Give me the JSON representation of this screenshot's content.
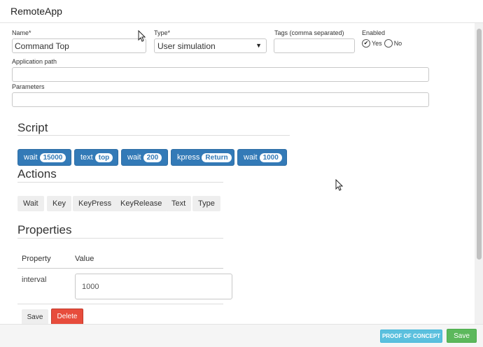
{
  "header": {
    "title": "RemoteApp"
  },
  "form": {
    "name": {
      "label": "Name*",
      "value": "Command Top"
    },
    "type": {
      "label": "Type*",
      "value": "User simulation"
    },
    "tags": {
      "label": "Tags (comma separated)",
      "value": ""
    },
    "enabled": {
      "label": "Enabled",
      "yes": "Yes",
      "no": "No",
      "selected": "Yes"
    },
    "app_path": {
      "label": "Application path",
      "value": ""
    },
    "parameters": {
      "label": "Parameters",
      "value": ""
    }
  },
  "script": {
    "title": "Script",
    "items": [
      {
        "cmd": "wait",
        "arg": "15000"
      },
      {
        "cmd": "text",
        "arg": "top"
      },
      {
        "cmd": "wait",
        "arg": "200"
      },
      {
        "cmd": "kpress",
        "arg": "Return"
      },
      {
        "cmd": "wait",
        "arg": "1000"
      }
    ]
  },
  "actions": {
    "title": "Actions",
    "items": [
      "Wait",
      "Key",
      "KeyPress",
      "KeyRelease",
      "Text",
      "Type"
    ]
  },
  "properties": {
    "title": "Properties",
    "col_property": "Property",
    "col_value": "Value",
    "rows": [
      {
        "name": "interval",
        "value": "1000"
      }
    ],
    "save_label": "Save",
    "delete_label": "Delete"
  },
  "footer": {
    "poc_label": "PROOF OF CONCEPT",
    "save_label": "Save"
  }
}
